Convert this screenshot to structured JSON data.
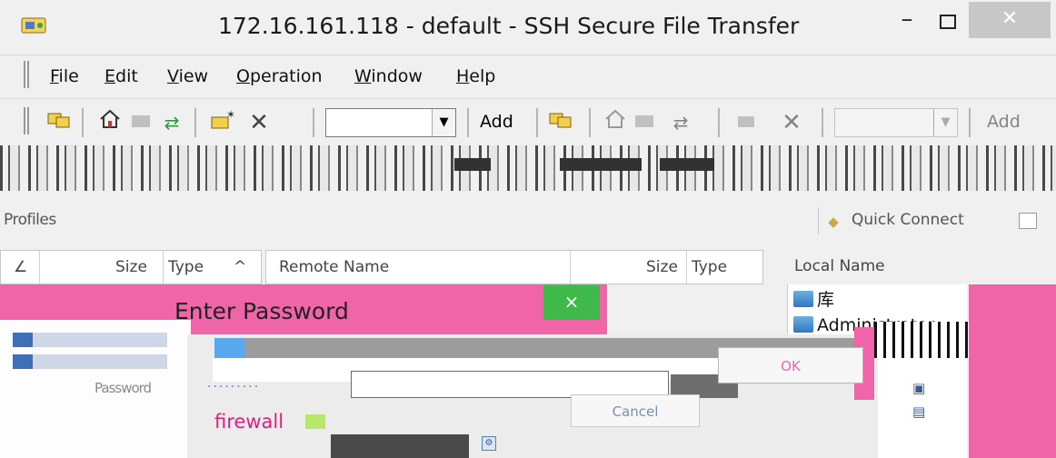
{
  "window": {
    "title": "172.16.161.118 - default - SSH Secure File Transfer",
    "minimize_glyph": "–",
    "close_glyph": "✕",
    "icon": "ssh-app-icon"
  },
  "menu": [
    "File",
    "Edit",
    "View",
    "Operation",
    "Window",
    "Help"
  ],
  "toolbar": {
    "left_add_label": "Add",
    "right_add_label": "Add",
    "left_profile_value": "",
    "right_profile_value": ""
  },
  "profiles": {
    "label": "Profiles",
    "quick_connect": "Quick Connect"
  },
  "remote_columns": {
    "left_sort_marker": "∠",
    "size": "Size",
    "type": "Type",
    "sort_arrow": "^",
    "remote_name": "Remote Name",
    "remote_size": "Size",
    "remote_type": "Type"
  },
  "local": {
    "header": "Local Name",
    "items": [
      "库",
      "Administrator"
    ]
  },
  "dialog": {
    "title": "Enter Password",
    "close_glyph": "×",
    "password_label": "Password",
    "ok_label": "OK",
    "cancel_label": "Cancel",
    "firewall_label": "firewall",
    "password_mask": "·········"
  },
  "colors": {
    "accent_pink": "#f064a8",
    "close_green": "#3fb94a",
    "window_close_gray": "#c7c7c7"
  }
}
